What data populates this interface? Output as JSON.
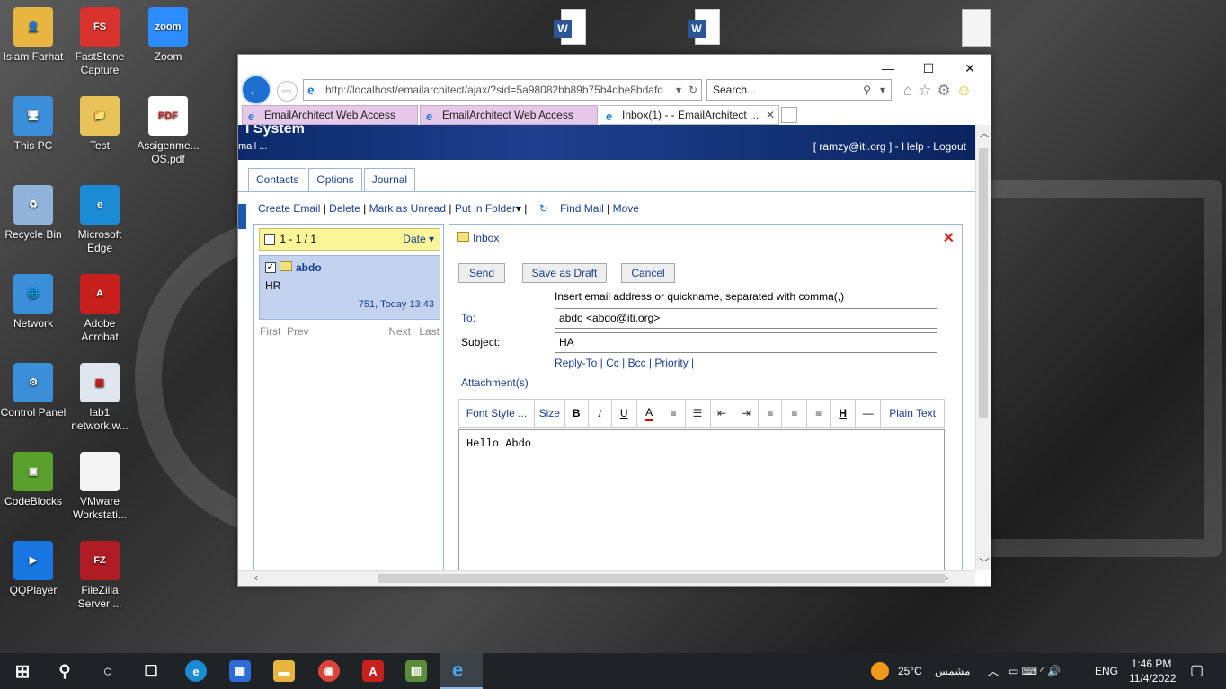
{
  "desktop": {
    "icons": [
      {
        "label": "Islam Farhat",
        "glyph": "👤",
        "color": "#e8b640"
      },
      {
        "label": "FastStone Capture",
        "glyph": "FS",
        "color": "#d8322c"
      },
      {
        "label": "Zoom",
        "glyph": "zoom",
        "color": "#2d8cff"
      },
      {
        "label": "This PC",
        "glyph": "🖥",
        "color": "#3a8fd8"
      },
      {
        "label": "Test",
        "glyph": "📁",
        "color": "#e8c35a"
      },
      {
        "label": "Assigenme... OS.pdf",
        "glyph": "PDF",
        "color": "#ffffff"
      },
      {
        "label": "Recycle Bin",
        "glyph": "♻",
        "color": "#8fb3d9"
      },
      {
        "label": "Microsoft Edge",
        "glyph": "e",
        "color": "#1b8bd6"
      },
      {
        "label": "Network",
        "glyph": "🌐",
        "color": "#3a8fd8"
      },
      {
        "label": "Adobe Acrobat",
        "glyph": "A",
        "color": "#c8201c"
      },
      {
        "label": "Control Panel",
        "glyph": "⚙",
        "color": "#3a8fd8"
      },
      {
        "label": "lab1 network.w...",
        "glyph": "▦",
        "color": "#dfe6ef"
      },
      {
        "label": "CodeBlocks",
        "glyph": "▣",
        "color": "#5aa02c"
      },
      {
        "label": "VMware Workstati...",
        "glyph": "",
        "color": "#f4f4f4"
      },
      {
        "label": "QQPlayer",
        "glyph": "▶",
        "color": "#1876e0"
      },
      {
        "label": "FileZilla Server ...",
        "glyph": "FZ",
        "color": "#b01c24"
      }
    ]
  },
  "browser": {
    "address": "http://localhost/emailarchitect/ajax/?sid=5a98082bb89b75b4dbe8bdafd",
    "address_host": "localhost",
    "search_placeholder": "Search...",
    "tabs": [
      {
        "label": "EmailArchitect Web Access"
      },
      {
        "label": "EmailArchitect Web Access"
      },
      {
        "label": "Inbox(1) - - EmailArchitect ..."
      }
    ]
  },
  "app": {
    "banner_title": "l System",
    "banner_sub": "mail ...",
    "user_bar": "[ ramzy@iti.org ] - Help - Logout",
    "nav_tabs": [
      "Contacts",
      "Options",
      "Journal"
    ],
    "actions": {
      "create": "Create Email",
      "delete": "Delete",
      "mark_unread": "Mark as Unread",
      "put_folder": "Put in Folder",
      "find": "Find Mail",
      "move": "Move"
    },
    "list": {
      "range": "1 - 1 / 1",
      "sort": "Date",
      "message": {
        "from": "abdo",
        "subject": "HR",
        "meta": "751, Today 13:43"
      },
      "pager": {
        "first": "First",
        "prev": "Prev",
        "next": "Next",
        "last": "Last"
      }
    },
    "compose": {
      "folder": "Inbox",
      "send": "Send",
      "save_draft": "Save as Draft",
      "cancel": "Cancel",
      "hint": "Insert email address or quickname, separated with comma(,)",
      "to_label": "To:",
      "to_value": "abdo <abdo@iti.org>",
      "subject_label": "Subject:",
      "subject_value": "HA",
      "extra_links": "Reply-To | Cc | Bcc | Priority |",
      "attachments": "Attachment(s)",
      "font_style": "Font Style ...",
      "size": "Size",
      "plain_text": "Plain Text",
      "body": "Hello Abdo"
    }
  },
  "taskbar": {
    "weather": "25°C",
    "weather_label": "مشمس",
    "lang": "ENG",
    "time": "1:46 PM",
    "date": "11/4/2022"
  }
}
